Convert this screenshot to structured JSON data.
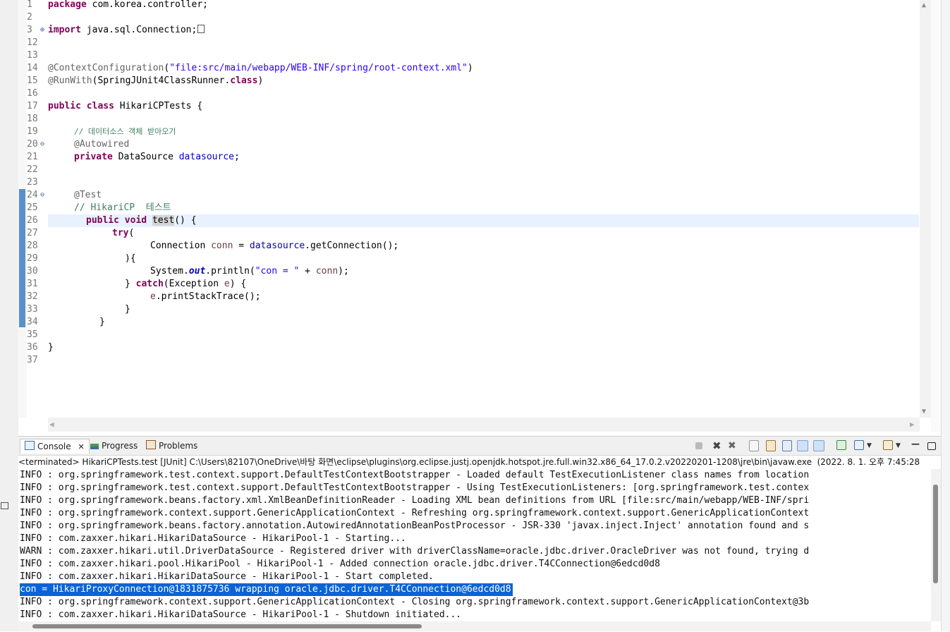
{
  "editor": {
    "lines": [
      {
        "num": "1"
      },
      {
        "num": "2"
      },
      {
        "num": "3"
      },
      {
        "num": "12"
      },
      {
        "num": "13"
      },
      {
        "num": "14"
      },
      {
        "num": "15"
      },
      {
        "num": "16"
      },
      {
        "num": "17"
      },
      {
        "num": "18"
      },
      {
        "num": "19"
      },
      {
        "num": "20"
      },
      {
        "num": "21"
      },
      {
        "num": "22"
      },
      {
        "num": "23"
      },
      {
        "num": "24"
      },
      {
        "num": "25"
      },
      {
        "num": "26"
      },
      {
        "num": "27"
      },
      {
        "num": "28"
      },
      {
        "num": "29"
      },
      {
        "num": "30"
      },
      {
        "num": "31"
      },
      {
        "num": "32"
      },
      {
        "num": "33"
      },
      {
        "num": "34"
      },
      {
        "num": "35"
      },
      {
        "num": "36"
      },
      {
        "num": "37"
      }
    ],
    "code": {
      "l1_kw": "package",
      "l1_rest": " com.korea.controller;",
      "l3_kw": "import",
      "l3_rest": " java.sql.Connection;",
      "l14_ann": "@ContextConfiguration",
      "l14_open": "(",
      "l14_str": "\"file:src/main/webapp/WEB-INF/spring/root-context.xml\"",
      "l14_close": ")",
      "l15_ann": "@RunWith",
      "l15_open": "(SpringJUnit4ClassRunner.",
      "l15_kw": "class",
      "l15_close": ")",
      "l17_kw": "public class",
      "l17_rest": " HikariCPTests {",
      "l19_cmt": "// 데이터소스 객체 받아오기",
      "l20_ann": "@Autowired",
      "l21_kw": "private",
      "l21_mid": " DataSource ",
      "l21_fld": "datasource",
      "l21_end": ";",
      "l24_ann": "@Test",
      "l25_cmt": "// HikariCP  테스트",
      "l26_kw": "public void",
      "l26_sp": " ",
      "l26_name": "test",
      "l26_end": "() {",
      "l27_kw": "try",
      "l27_end": "(",
      "l28_a": "Connection ",
      "l28_loc": "conn",
      "l28_b": " = ",
      "l28_fld": "datasource",
      "l28_c": ".getConnection();",
      "l29": "){",
      "l30_a": "System.",
      "l30_sfld": "out",
      "l30_b": ".println(",
      "l30_str": "\"con = \"",
      "l30_c": " + ",
      "l30_loc": "conn",
      "l30_d": ");",
      "l31_a": "} ",
      "l31_kw": "catch",
      "l31_b": "(Exception ",
      "l31_loc": "e",
      "l31_c": ") {",
      "l32_loc": "e",
      "l32_rest": ".printStackTrace();",
      "l33": "}",
      "l34": "}",
      "l36": "}"
    }
  },
  "console": {
    "tabs": [
      {
        "label": "Console"
      },
      {
        "label": "Progress"
      },
      {
        "label": "Problems"
      }
    ],
    "status": "<terminated> HikariCPTests.test [JUnit] C:\\Users\\82107\\OneDrive\\바탕 화면\\eclipse\\plugins\\org.eclipse.justj.openjdk.hotspot.jre.full.win32.x86_64_17.0.2.v20220201-1208\\jre\\bin\\javaw.exe  (2022. 8. 1. 오후 7:45:28",
    "lines": [
      "INFO : org.springframework.test.context.support.DefaultTestContextBootstrapper - Loaded default TestExecutionListener class names from location",
      "INFO : org.springframework.test.context.support.DefaultTestContextBootstrapper - Using TestExecutionListeners: [org.springframework.test.contex",
      "INFO : org.springframework.beans.factory.xml.XmlBeanDefinitionReader - Loading XML bean definitions from URL [file:src/main/webapp/WEB-INF/spri",
      "INFO : org.springframework.context.support.GenericApplicationContext - Refreshing org.springframework.context.support.GenericApplicationContext",
      "INFO : org.springframework.beans.factory.annotation.AutowiredAnnotationBeanPostProcessor - JSR-330 'javax.inject.Inject' annotation found and s",
      "INFO : com.zaxxer.hikari.HikariDataSource - HikariPool-1 - Starting...",
      "WARN : com.zaxxer.hikari.util.DriverDataSource - Registered driver with driverClassName=oracle.jdbc.driver.OracleDriver was not found, trying d",
      "INFO : com.zaxxer.hikari.pool.HikariPool - HikariPool-1 - Added connection oracle.jdbc.driver.T4CConnection@6edcd0d8",
      "INFO : com.zaxxer.hikari.HikariDataSource - HikariPool-1 - Start completed.",
      "con = HikariProxyConnection@1831875736 wrapping oracle.jdbc.driver.T4CConnection@6edcd0d8",
      "INFO : org.springframework.context.support.GenericApplicationContext - Closing org.springframework.context.support.GenericApplicationContext@3b",
      "INFO : com.zaxxer.hikari.HikariDataSource - HikariPool-1 - Shutdown initiated..."
    ],
    "selected_line_index": 9
  },
  "toolbar_icons": [
    "terminate-icon",
    "remove-launch-icon",
    "remove-all-terminated-icon",
    "clear-console-icon",
    "scroll-lock-icon",
    "word-wrap-icon",
    "show-on-stdout-icon",
    "show-on-stderr-icon",
    "pin-console-icon",
    "display-console-icon",
    "open-console-icon",
    "minimize-icon",
    "maximize-icon"
  ],
  "colors": {
    "keyword": "#7f0055",
    "annotation": "#646464",
    "string": "#2a00ff",
    "comment": "#3f7f5f",
    "field": "#0000c0",
    "selection": "#0a64d6"
  }
}
